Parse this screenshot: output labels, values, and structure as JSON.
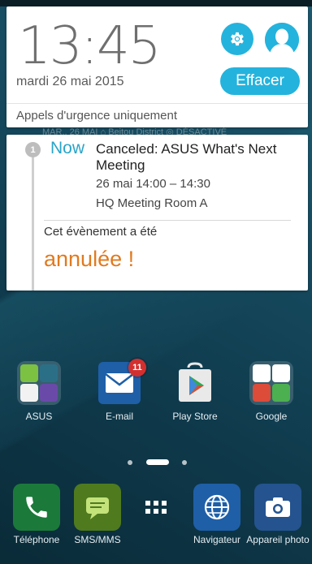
{
  "quick_settings": {
    "time": "13:45",
    "date": "mardi 26 mai 2015",
    "clear_label": "Effacer",
    "emergency_text": "Appels d'urgence uniquement",
    "settings_icon": "gear-icon",
    "profile_icon": "user-avatar-icon"
  },
  "ghost_status": "MAR., 26 MAI  ⌂ Beitou District  ◎ DÉSACTIVÉ",
  "notification": {
    "count": "1",
    "when": "Now",
    "title": "Canceled: ASUS What's Next Meeting",
    "time": "26 mai 14:00 – 14:30",
    "location": "HQ Meeting Room A",
    "body": "Cet évènement a été",
    "status": "annulée !"
  },
  "home": {
    "apps": [
      {
        "label": "ASUS",
        "icon": "asus-folder-icon"
      },
      {
        "label": "E-mail",
        "icon": "email-icon",
        "badge": "11"
      },
      {
        "label": "Play Store",
        "icon": "play-store-icon"
      },
      {
        "label": "Google",
        "icon": "google-folder-icon"
      }
    ],
    "dock": [
      {
        "label": "Téléphone",
        "icon": "phone-icon"
      },
      {
        "label": "SMS/MMS",
        "icon": "sms-icon"
      },
      {
        "label": "",
        "icon": "app-drawer-icon"
      },
      {
        "label": "Navigateur",
        "icon": "browser-globe-icon"
      },
      {
        "label": "Appareil photo",
        "icon": "camera-icon"
      }
    ]
  },
  "colors": {
    "accent": "#24b3dd",
    "now": "#2aa4c8",
    "cancel": "#e07a1f",
    "badge": "#d32f2f"
  }
}
